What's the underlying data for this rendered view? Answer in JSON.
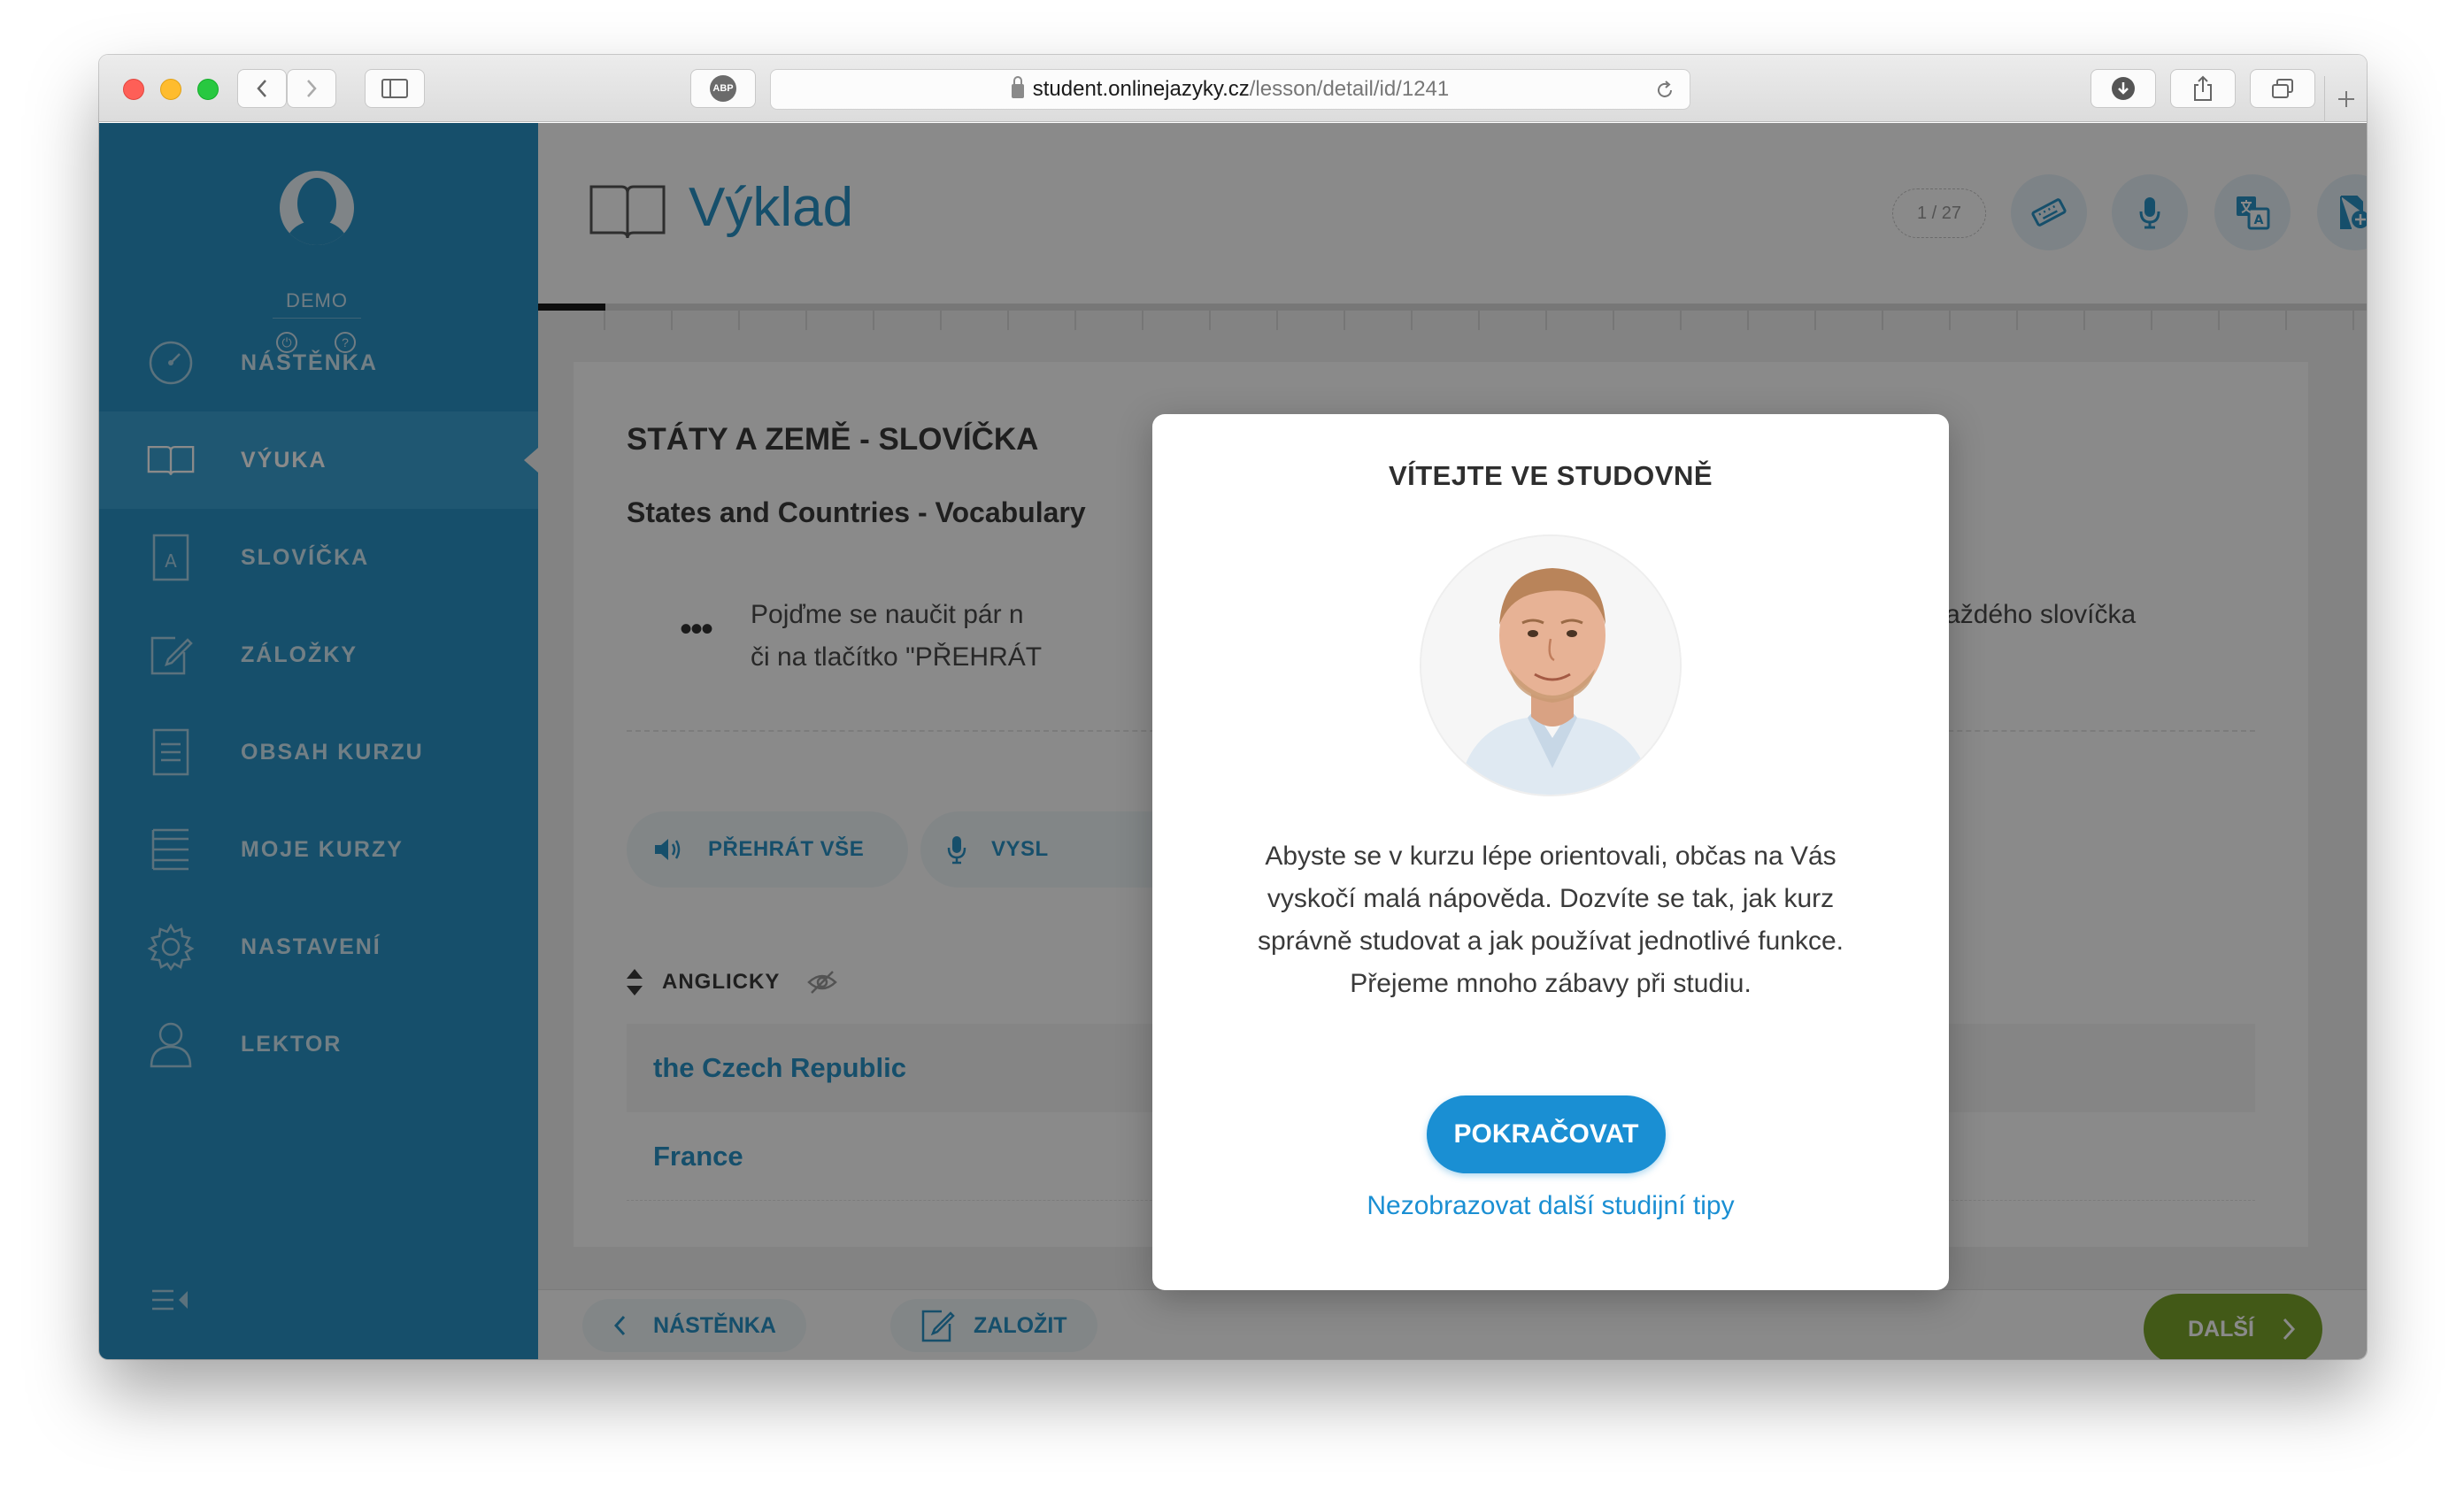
{
  "browser": {
    "url_host": "student.onlinejazyky.cz",
    "url_path": "/lesson/detail/id/1241",
    "adblock_label": "ABP"
  },
  "sidebar": {
    "username": "DEMO",
    "items": [
      {
        "label": "NÁSTĚNKA",
        "icon": "dashboard-icon"
      },
      {
        "label": "VÝUKA",
        "icon": "book-icon"
      },
      {
        "label": "SLOVÍČKA",
        "icon": "vocabulary-icon"
      },
      {
        "label": "ZÁLOŽKY",
        "icon": "bookmark-edit-icon"
      },
      {
        "label": "OBSAH KURZU",
        "icon": "document-icon"
      },
      {
        "label": "MOJE KURZY",
        "icon": "list-icon"
      },
      {
        "label": "NASTAVENÍ",
        "icon": "gear-icon"
      },
      {
        "label": "LEKTOR",
        "icon": "user-icon"
      }
    ]
  },
  "header": {
    "title": "Výklad",
    "counter": "1 / 27"
  },
  "lesson": {
    "title": "STÁTY A ZEMĚ - SLOVÍČKA",
    "subtitle": "States and Countries - Vocabulary",
    "intro_line1": "Pojďme se naučit pár n",
    "intro_line1_end": "ru vedle každého slovíčka",
    "intro_line2": "či na tlačítko \"PŘEHRÁT",
    "play_all": "PŘEHRÁT VŠE",
    "speak": "VYSL",
    "language_header": "ANGLICKY",
    "rows": [
      "the Czech Republic",
      "France"
    ]
  },
  "bottom": {
    "back_label": "NÁSTĚNKA",
    "bookmark_label": "ZALOŽIT",
    "next_label": "DALŠÍ"
  },
  "modal": {
    "title": "VÍTEJTE VE STUDOVNĚ",
    "body_line1": "Abyste se v kurzu lépe orientovali, občas na Vás",
    "body_line2": "vyskočí malá nápověda. Dozvíte se tak, jak kurz",
    "body_line3": "správně studovat a jak používat jednotlivé funkce.",
    "body_line4": "Přejeme mnoho zábavy při studiu.",
    "continue_label": "POKRAČOVAT",
    "dismiss_label": "Nezobrazovat další studijní tipy"
  },
  "colors": {
    "brand_blue": "#2a93c6",
    "cta_blue": "#1a8fd3",
    "next_green": "#7aa52c"
  }
}
